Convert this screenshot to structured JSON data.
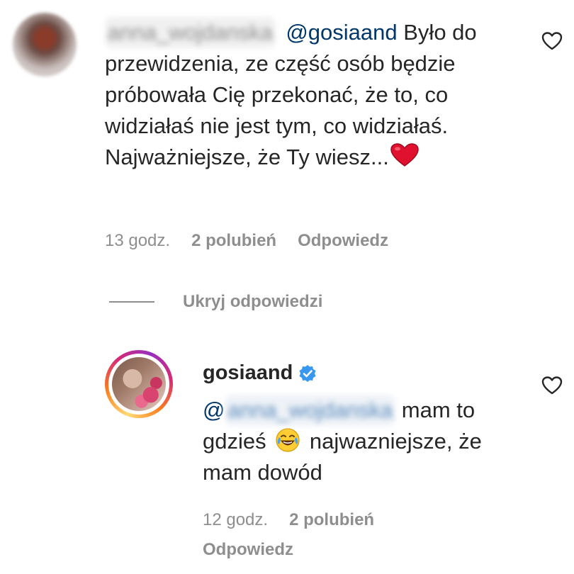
{
  "comment": {
    "username": "anna_wojdanska",
    "mention": "@gosiaand",
    "text": "Było do przewidzenia, ze część osób będzie próbowała Cię przekonać, że to, co widziałaś nie jest tym, co widziałaś. Najważniejsze, że Ty wiesz...",
    "emoji": "red-heart",
    "time": "13 godz.",
    "likes": "2 polubień",
    "reply_label": "Odpowiedz"
  },
  "hide_replies_label": "Ukryj odpowiedzi",
  "reply": {
    "username": "gosiaand",
    "verified": true,
    "mention_at": "@",
    "mention_name": "anna_wojdanska",
    "text_part1": "mam to gdzieś",
    "emoji": "face-with-tears-of-joy",
    "text_part2": "najwazniejsze, że mam dowód",
    "time": "12 godz.",
    "likes": "2 polubień",
    "reply_label": "Odpowiedz"
  },
  "colors": {
    "text": "#262626",
    "muted": "#8e8e8e",
    "mention": "#00376b",
    "verified": "#3897f0",
    "heart": "#e0102f"
  }
}
